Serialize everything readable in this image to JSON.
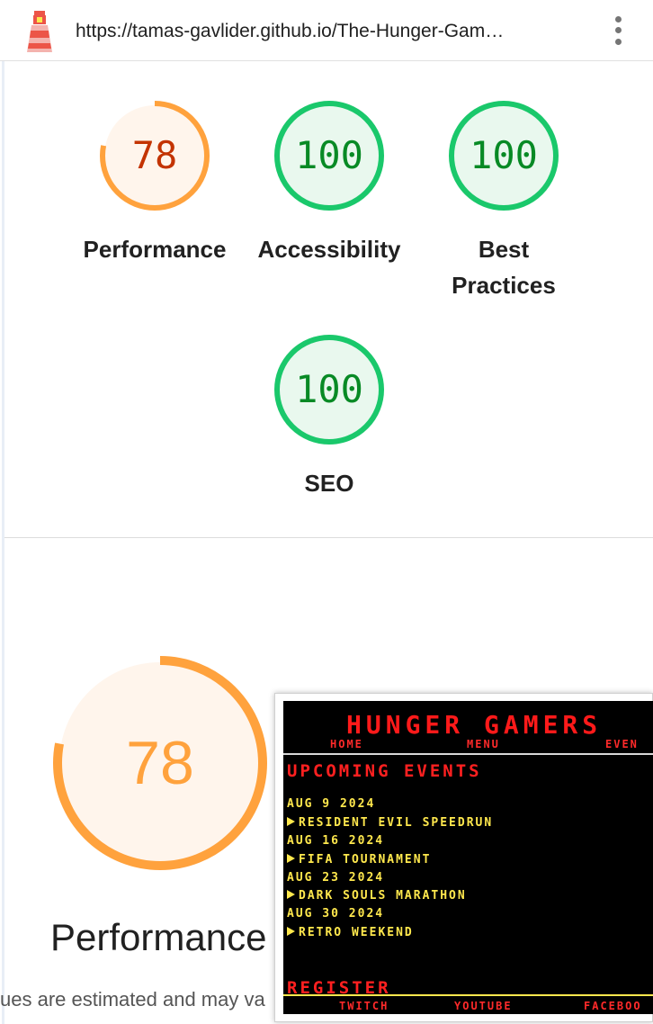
{
  "browser": {
    "url": "https://tamas-gavlider.github.io/The-Hunger-Gam…",
    "icons": {
      "logo": "lighthouse-icon",
      "menu": "more-vert-icon"
    }
  },
  "colors": {
    "average": "#ffa23d",
    "average_text": "#c33300",
    "average_bg": "#fff5ec",
    "pass": "#1ac86b",
    "pass_text": "#088a25",
    "pass_bg": "#e9f8ee"
  },
  "scores": [
    {
      "id": "performance",
      "score": 78,
      "label": "Performance"
    },
    {
      "id": "accessibility",
      "score": 100,
      "label": "Accessibility"
    },
    {
      "id": "best-practices",
      "score": 100,
      "label_line1": "Best",
      "label_line2": "Practices"
    },
    {
      "id": "seo",
      "score": 100,
      "label": "SEO"
    }
  ],
  "detail": {
    "score": 78,
    "label": "Performance",
    "note": "ues are estimated and may va"
  },
  "thumbnail": {
    "site_title": "HUNGER GAMERS",
    "nav": [
      "HOME",
      "MENU",
      "EVEN"
    ],
    "section_heading": "UPCOMING EVENTS",
    "events": [
      {
        "date": "AUG 9 2024",
        "name": "RESIDENT EVIL SPEEDRUN"
      },
      {
        "date": "AUG 16 2024",
        "name": "FIFA TOURNAMENT"
      },
      {
        "date": "AUG 23 2024",
        "name": "DARK SOULS MARATHON"
      },
      {
        "date": "AUG 30 2024",
        "name": "RETRO WEEKEND"
      }
    ],
    "register_heading": "REGISTER",
    "footer_links": [
      "TWITCH",
      "YOUTUBE",
      "FACEBOO"
    ]
  }
}
